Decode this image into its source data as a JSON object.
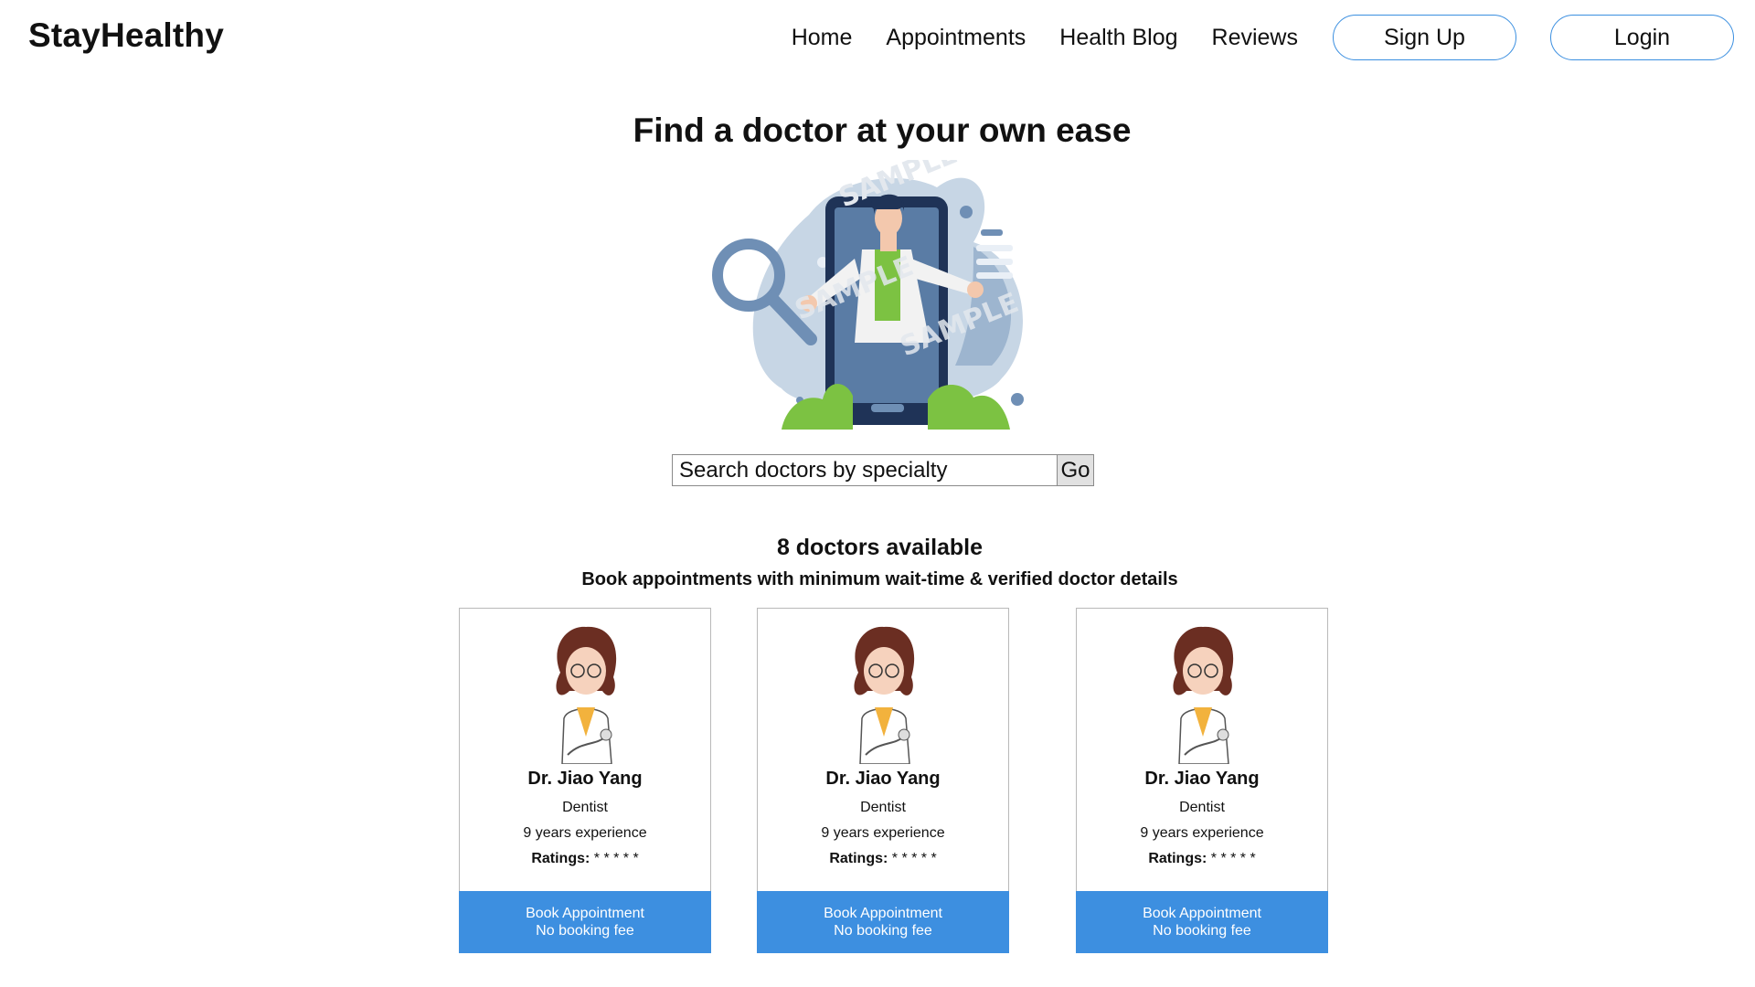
{
  "app": {
    "name": "StayHealthy"
  },
  "nav": {
    "links": [
      "Home",
      "Appointments",
      "Health Blog",
      "Reviews"
    ],
    "signup_label": "Sign Up",
    "login_label": "Login",
    "accent": "#3b8fe0"
  },
  "hero": {
    "title": "Find a doctor at your own ease",
    "watermark": "SAMPLE"
  },
  "search": {
    "placeholder": "Search doctors by specialty",
    "button_label": "Go"
  },
  "listing": {
    "count_text": "8 doctors available",
    "subtitle": "Book appointments with minimum wait-time & verified doctor details"
  },
  "doctors": [
    {
      "name": "Dr. Jiao Yang",
      "specialty": "Dentist",
      "experience": "9 years experience",
      "ratings_label": "Ratings:",
      "ratings_value": "* * * * *",
      "book_label": "Book Appointment",
      "fee_label": "No booking fee"
    },
    {
      "name": "Dr. Jiao Yang",
      "specialty": "Dentist",
      "experience": "9 years experience",
      "ratings_label": "Ratings:",
      "ratings_value": "* * * * *",
      "book_label": "Book Appointment",
      "fee_label": "No booking fee"
    },
    {
      "name": "Dr. Jiao Yang",
      "specialty": "Dentist",
      "experience": "9 years experience",
      "ratings_label": "Ratings:",
      "ratings_value": "* * * * *",
      "book_label": "Book Appointment",
      "fee_label": "No booking fee"
    }
  ],
  "colors": {
    "book_button": "#3d8fe0",
    "card_border": "#b9b9b9",
    "illustration_green": "#7cc242",
    "illustration_navy": "#1f3357"
  }
}
